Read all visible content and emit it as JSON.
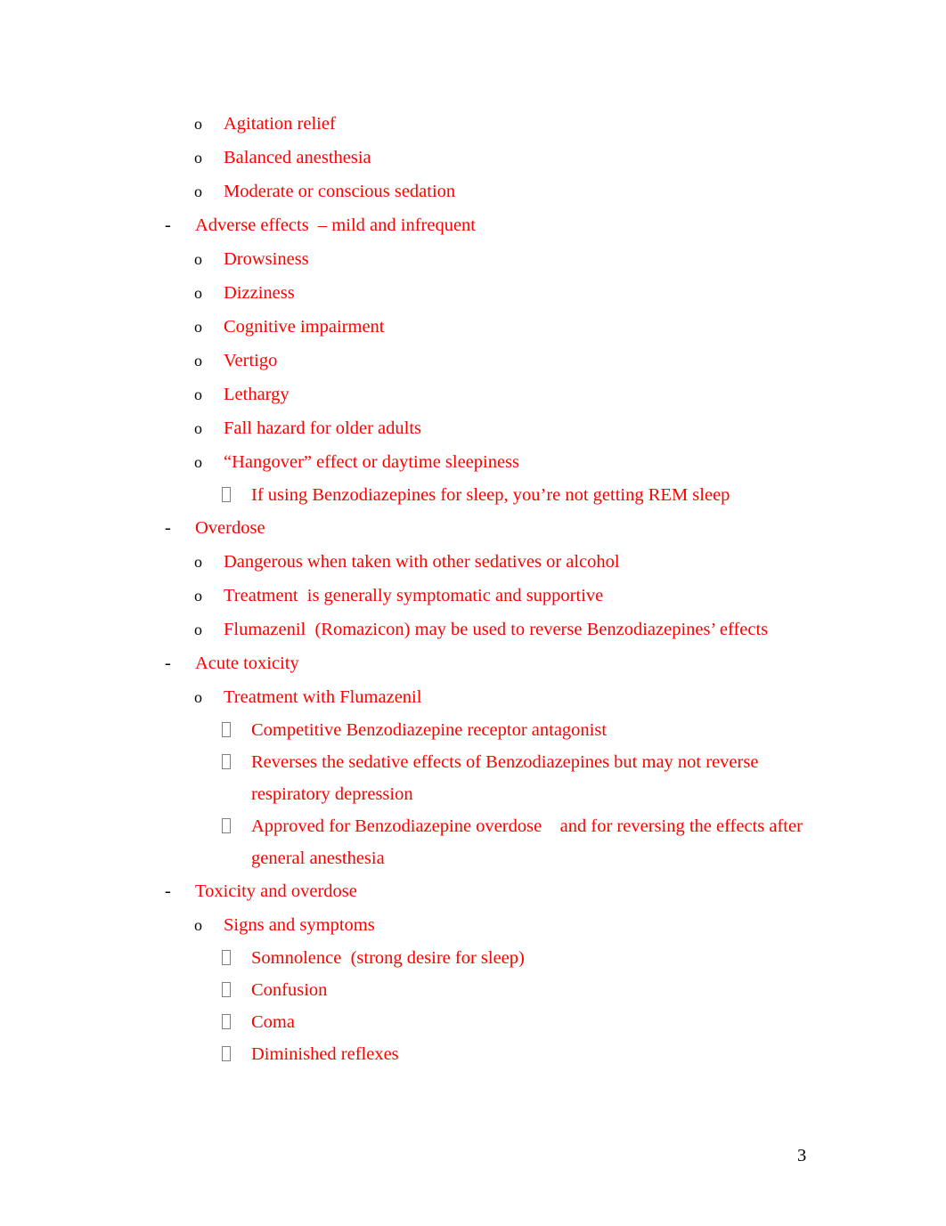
{
  "document": {
    "page_number": "3",
    "text_color": "#FF0000",
    "marker_color": "#000000",
    "background_color": "#FFFFFF"
  },
  "outline": [
    {
      "level": 2,
      "marker": "o",
      "text": "Agitation relief"
    },
    {
      "level": 2,
      "marker": "o",
      "text": "Balanced anesthesia"
    },
    {
      "level": 2,
      "marker": "o",
      "text": "Moderate or conscious sedation"
    },
    {
      "level": 1,
      "marker": "-",
      "text": "Adverse effects  – mild and infrequent"
    },
    {
      "level": 2,
      "marker": "o",
      "text": "Drowsiness"
    },
    {
      "level": 2,
      "marker": "o",
      "text": "Dizziness"
    },
    {
      "level": 2,
      "marker": "o",
      "text": "Cognitive impairment"
    },
    {
      "level": 2,
      "marker": "o",
      "text": "Vertigo"
    },
    {
      "level": 2,
      "marker": "o",
      "text": "Lethargy"
    },
    {
      "level": 2,
      "marker": "o",
      "text": "Fall hazard for older adults"
    },
    {
      "level": 2,
      "marker": "o",
      "text": "“Hangover” effect or daytime sleepiness"
    },
    {
      "level": 3,
      "marker": "box",
      "text": "If using Benzodiazepines for sleep, you’re not getting REM sleep"
    },
    {
      "level": 1,
      "marker": "-",
      "text": "Overdose"
    },
    {
      "level": 2,
      "marker": "o",
      "text": "Dangerous when taken with other sedatives or alcohol"
    },
    {
      "level": 2,
      "marker": "o",
      "text": "Treatment  is generally symptomatic and supportive"
    },
    {
      "level": 2,
      "marker": "o",
      "text": "Flumazenil  (Romazicon) may be used to reverse Benzodiazepines’ effects"
    },
    {
      "level": 1,
      "marker": "-",
      "text": "Acute toxicity"
    },
    {
      "level": 2,
      "marker": "o",
      "text": "Treatment with Flumazenil"
    },
    {
      "level": 3,
      "marker": "box",
      "text": "Competitive Benzodiazepine receptor antagonist"
    },
    {
      "level": 3,
      "marker": "box",
      "text": "Reverses the sedative effects of Benzodiazepines but may not reverse respiratory depression"
    },
    {
      "level": 3,
      "marker": "box",
      "text": "Approved for Benzodiazepine overdose    and for reversing the effects after general anesthesia"
    },
    {
      "level": 1,
      "marker": "-",
      "text": "Toxicity and overdose"
    },
    {
      "level": 2,
      "marker": "o",
      "text": "Signs and symptoms"
    },
    {
      "level": 3,
      "marker": "box",
      "text": "Somnolence  (strong desire for sleep)"
    },
    {
      "level": 3,
      "marker": "box",
      "text": "Confusion"
    },
    {
      "level": 3,
      "marker": "box",
      "text": "Coma"
    },
    {
      "level": 3,
      "marker": "box",
      "text": "Diminished reflexes"
    }
  ]
}
